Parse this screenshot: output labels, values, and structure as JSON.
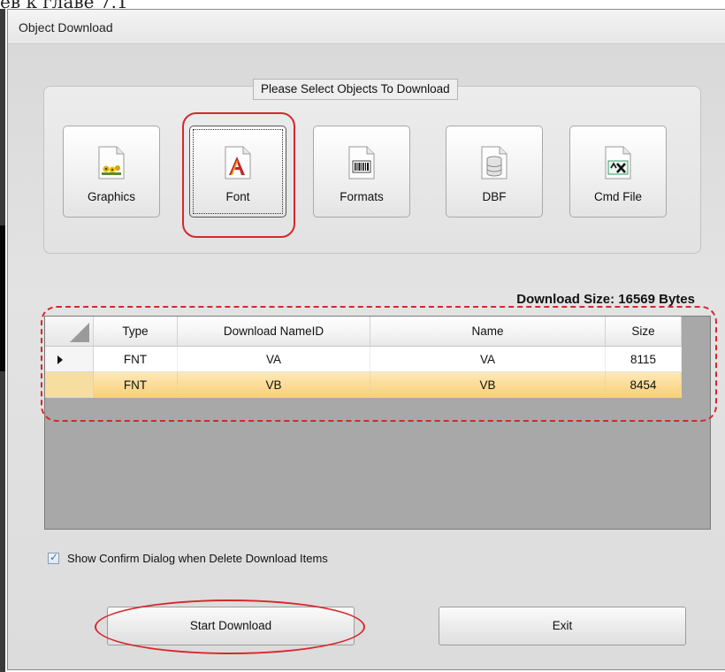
{
  "doc_fragment": "ев к главе 7.1",
  "window": {
    "title": "Object Download"
  },
  "object_select": {
    "legend": "Please Select Objects To Download",
    "buttons": [
      {
        "label": "Graphics",
        "icon": "graphics-file-icon",
        "selected": false
      },
      {
        "label": "Font",
        "icon": "font-file-icon",
        "selected": true
      },
      {
        "label": "Formats",
        "icon": "formats-file-icon",
        "selected": false
      },
      {
        "label": "DBF",
        "icon": "database-file-icon",
        "selected": false
      },
      {
        "label": "Cmd File",
        "icon": "cmd-file-icon",
        "selected": false
      }
    ]
  },
  "download_size": "Download Size: 16569 Bytes",
  "table": {
    "columns": [
      "Type",
      "Download NameID",
      "Name",
      "Size"
    ],
    "rows": [
      [
        "FNT",
        "VA",
        "VA",
        "8115"
      ],
      [
        "FNT",
        "VB",
        "VB",
        "8454"
      ]
    ],
    "current_row": 0,
    "selected_row": 1
  },
  "confirm_checkbox": {
    "label": "Show Confirm Dialog when Delete Download Items",
    "checked": true
  },
  "buttons": {
    "start": "Start Download",
    "exit": "Exit"
  },
  "colors": {
    "annotation_red": "#d6282d",
    "selected_row": "#f8cf78",
    "grid_background": "#a8a8a8"
  }
}
